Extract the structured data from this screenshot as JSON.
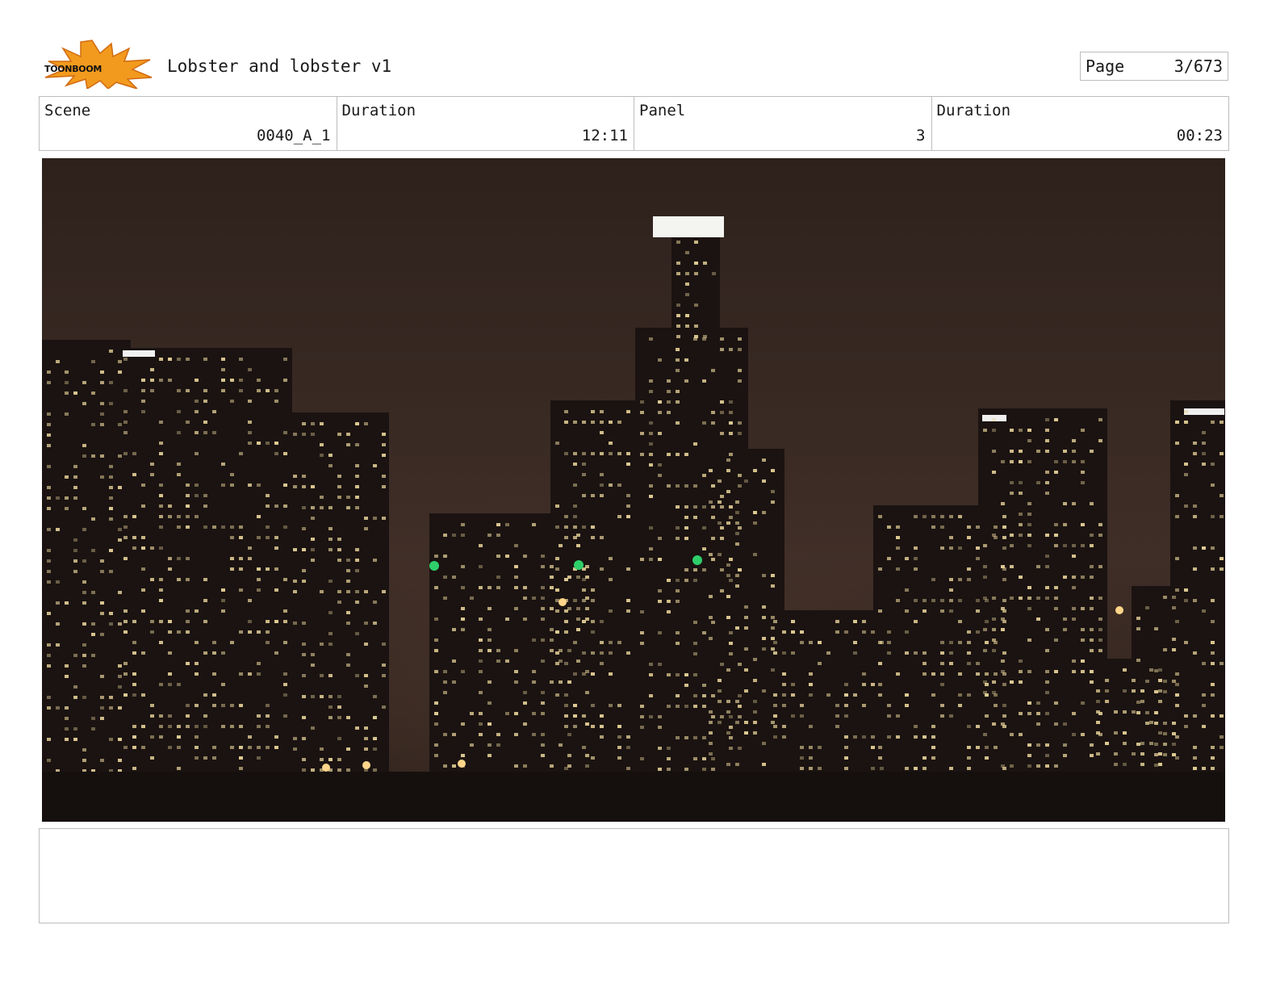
{
  "header": {
    "logo_text": "TOONBOOM",
    "title": "Lobster and lobster v1",
    "page_label": "Page",
    "page_value": "3/673"
  },
  "info": {
    "scene_label": "Scene",
    "scene_value": "0040_A_1",
    "duration_label": "Duration",
    "duration_value": "12:11",
    "panel_label": "Panel",
    "panel_value": "3",
    "panel_duration_label": "Duration",
    "panel_duration_value": "00:23"
  },
  "colors": {
    "sky": "#3a2a24",
    "building": "#1a1311",
    "window": "#e8d39a",
    "logo_orange": "#f29a1e"
  },
  "notes": ""
}
